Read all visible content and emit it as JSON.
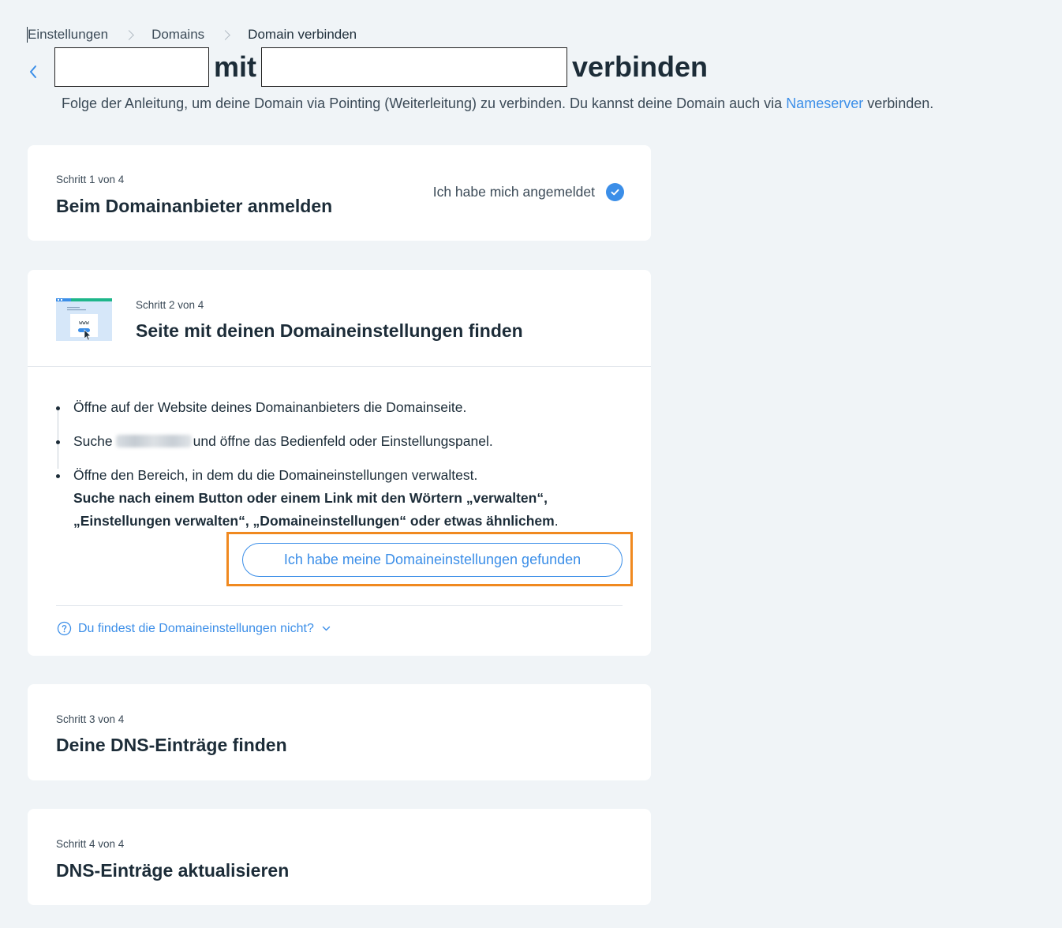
{
  "breadcrumb": {
    "items": [
      "Einstellungen",
      "Domains",
      "Domain verbinden"
    ]
  },
  "header": {
    "title_connector": "mit",
    "title_suffix": "verbinden",
    "subtitle_text": "Folge der Anleitung, um deine Domain via Pointing (Weiterleitung) zu verbinden. Du kannst deine Domain auch via ",
    "subtitle_link": "Nameserver",
    "subtitle_end": " verbinden."
  },
  "steps": [
    {
      "label": "Schritt 1 von 4",
      "title": "Beim Domainanbieter anmelden",
      "status": "Ich habe mich angemeldet"
    },
    {
      "label": "Schritt 2 von 4",
      "title": "Seite mit deinen Domaineinstellungen finden",
      "instructions": {
        "item1": "Öffne auf der Website deines Domainanbieters die Domainseite.",
        "item2_prefix": "Suche",
        "item2_suffix": "und öffne das Bedienfeld oder Einstellungspanel.",
        "item3_text": "Öffne den Bereich, in dem du die Domaineinstellungen verwaltest.",
        "item3_bold": "Suche nach einem Button oder einem Link mit den Wörtern „verwalten“, „Einstellungen verwalten“, „Domaineinstellungen“ oder etwas ähnlichem",
        "item3_end": "."
      },
      "button": "Ich habe meine Domaineinstellungen gefunden",
      "help": "Du findest die Domaineinstellungen nicht?",
      "illustration_text": "www"
    },
    {
      "label": "Schritt 3 von 4",
      "title": "Deine DNS-Einträge finden"
    },
    {
      "label": "Schritt 4 von 4",
      "title": "DNS-Einträge aktualisieren"
    }
  ],
  "colors": {
    "accent": "#3b8ee8",
    "highlight": "#f0891f",
    "background": "#f0f4f7",
    "illustration_green": "#1eb68a"
  },
  "icons": [
    "chevron-left-icon",
    "chevron-right-icon",
    "check-circle-icon",
    "question-circle-icon",
    "chevron-down-icon",
    "browser-illustration",
    "cursor-icon"
  ]
}
